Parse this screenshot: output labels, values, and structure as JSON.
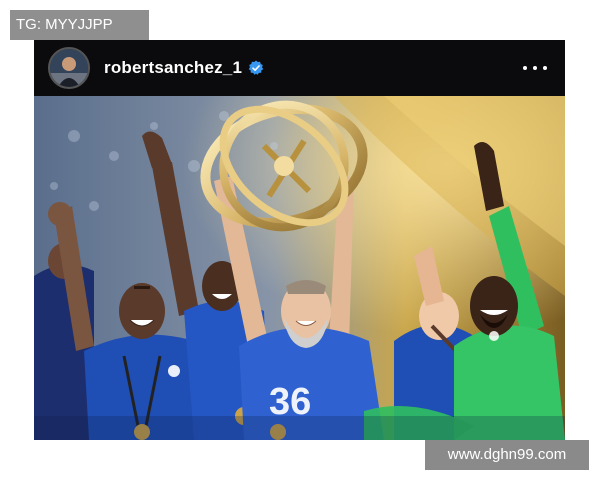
{
  "overlay": {
    "tag_text": "TG: MYYJJPP",
    "watermark_text": "www.dghn99.com"
  },
  "post": {
    "username": "robertsanchez_1",
    "verified": true,
    "more_icon": "more-horizontal-icon",
    "image_caption_visible": "",
    "shirt_number": "36"
  },
  "colors": {
    "header_bg": "#0b0b0d",
    "verified_blue": "#3897f0",
    "kit_blue": "#1f4fb5",
    "keeper_green": "#2fbf5f",
    "trophy_gold": "#d8b66a"
  }
}
